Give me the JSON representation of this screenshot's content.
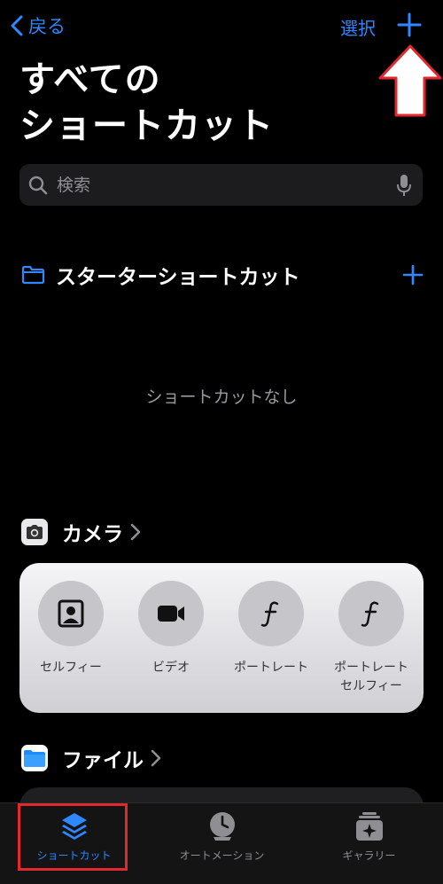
{
  "nav": {
    "back_label": "戻る",
    "select_label": "選択"
  },
  "title": {
    "line1": "すべての",
    "line2": "ショートカット"
  },
  "search": {
    "placeholder": "検索"
  },
  "starter": {
    "label": "スターターショートカット",
    "empty_text": "ショートカットなし"
  },
  "camera": {
    "label": "カメラ",
    "items": [
      {
        "label": "セルフィー",
        "icon": "portrait-icon"
      },
      {
        "label": "ビデオ",
        "icon": "video-camera-icon"
      },
      {
        "label": "ポートレート",
        "icon": "f-function-icon"
      },
      {
        "label": "ポートレート\nセルフィー",
        "icon": "f-function-icon"
      }
    ]
  },
  "files": {
    "label": "ファイル"
  },
  "tabs": [
    {
      "label": "ショートカット",
      "icon": "layers-icon",
      "active": true
    },
    {
      "label": "オートメーション",
      "icon": "clock-check-icon",
      "active": false
    },
    {
      "label": "ギャラリー",
      "icon": "gallery-sparkle-icon",
      "active": false
    }
  ],
  "colors": {
    "accent": "#2f88ff",
    "callout": "#e0282e",
    "background": "#000000"
  }
}
